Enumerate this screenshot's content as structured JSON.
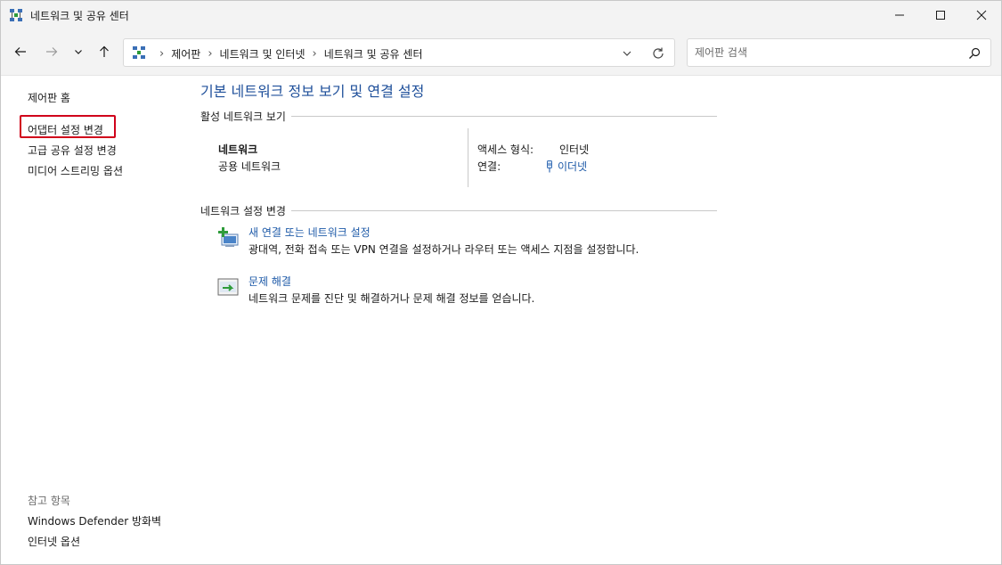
{
  "window": {
    "title": "네트워크 및 공유 센터",
    "minimize": "minimize",
    "maximize": "maximize",
    "close": "close"
  },
  "nav": {
    "breadcrumbs": [
      "제어판",
      "네트워크 및 인터넷",
      "네트워크 및 공유 센터"
    ],
    "search_placeholder": "제어판 검색"
  },
  "left": {
    "home": "제어판 홈",
    "adapter": "어댑터 설정 변경",
    "advanced": "고급 공유 설정 변경",
    "media": "미디어 스트리밍 옵션",
    "see_also_title": "참고 항목",
    "defender": "Windows Defender 방화벽",
    "internet_options": "인터넷 옵션"
  },
  "main": {
    "title": "기본 네트워크 정보 보기 및 연결 설정",
    "active_section": "활성 네트워크 보기",
    "network_name": "네트워크",
    "network_type": "공용 네트워크",
    "access_type_label": "액세스 형식:",
    "access_type_value": "인터넷",
    "connection_label": "연결:",
    "connection_value": "이더넷",
    "change_section": "네트워크 설정 변경",
    "tasks": [
      {
        "title": "새 연결 또는 네트워크 설정",
        "desc": "광대역, 전화 접속 또는 VPN 연결을 설정하거나 라우터 또는 액세스 지점을 설정합니다."
      },
      {
        "title": "문제 해결",
        "desc": "네트워크 문제를 진단 및 해결하거나 문제 해결 정보를 얻습니다."
      }
    ]
  },
  "colors": {
    "accent_link": "#1e5aa8",
    "title_blue": "#1e4f9a",
    "highlight_box": "#d0021b",
    "chrome_bg": "#f3f3f3"
  }
}
